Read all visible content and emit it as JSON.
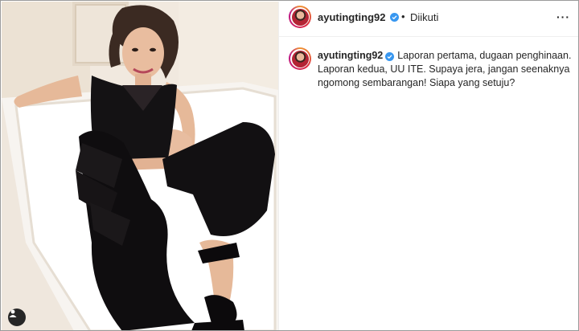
{
  "post": {
    "username": "ayutingting92",
    "follow_status": "Diikuti",
    "separator": "•",
    "more_icon": "more-horizontal-icon",
    "caption": "Laporan pertama, dugaan penghinaan. Laporan kedua, UU ITE. Supaya jera, jangan seenaknya ngomong sembarangan! Siapa yang setuju?"
  },
  "colors": {
    "verified": "#3897f0",
    "text": "#262626",
    "divider": "#efefef"
  }
}
